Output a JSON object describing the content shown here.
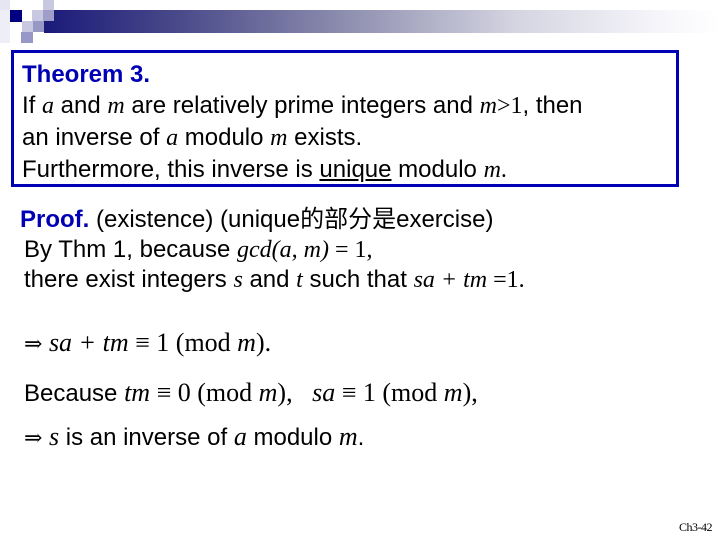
{
  "header": {
    "decoration": "gradient-bar-with-squares"
  },
  "theorem": {
    "title": "Theorem 3.",
    "line1": {
      "t1": "If ",
      "v_a": "a",
      "t2": " and ",
      "v_m": "m",
      "t3": " are relatively prime integers and ",
      "v_m2": "m",
      "cond": ">1",
      "t4": ", then"
    },
    "line2": {
      "t1": "an inverse of ",
      "v_a": "a",
      "t2": " modulo ",
      "v_m": "m",
      "t3": " exists."
    },
    "line3": {
      "t1": "Furthermore, this inverse is ",
      "underlined": "unique",
      "t2": " modulo ",
      "v_m": "m",
      "t3": "."
    }
  },
  "proof": {
    "title": "Proof.",
    "subtitle": " (existence) (unique的部分是exercise)",
    "line1": {
      "t1": "By Thm 1, because ",
      "expr": "gcd(a, m)",
      "eq": " = 1,"
    },
    "line2": {
      "t1": "there exist integers ",
      "v_s": "s",
      "t2": " and ",
      "v_t": "t",
      "t3": " such that ",
      "expr": "sa + tm",
      "eq": " =1."
    },
    "line3": {
      "arrow": "⇒",
      "expr": " sa + tm ",
      "equiv": "≡",
      "rest": " 1 (mod ",
      "v_m": "m",
      "close": ")."
    },
    "line4": {
      "t1": "Because ",
      "expr1": "tm",
      "equiv1": " ≡ ",
      "rest1": "0 (mod ",
      "v_m1": "m",
      "close1": "),   ",
      "expr2": "sa",
      "equiv2": " ≡ ",
      "rest2": "1 (mod ",
      "v_m2": "m",
      "close2": "),"
    },
    "line5": {
      "arrow": "⇒",
      "v_s": " s",
      "t1": " is an inverse of ",
      "v_a": "a",
      "t2": " modulo ",
      "v_m": "m",
      "t3": "."
    }
  },
  "footer": {
    "slide_number": "Ch3-42"
  }
}
